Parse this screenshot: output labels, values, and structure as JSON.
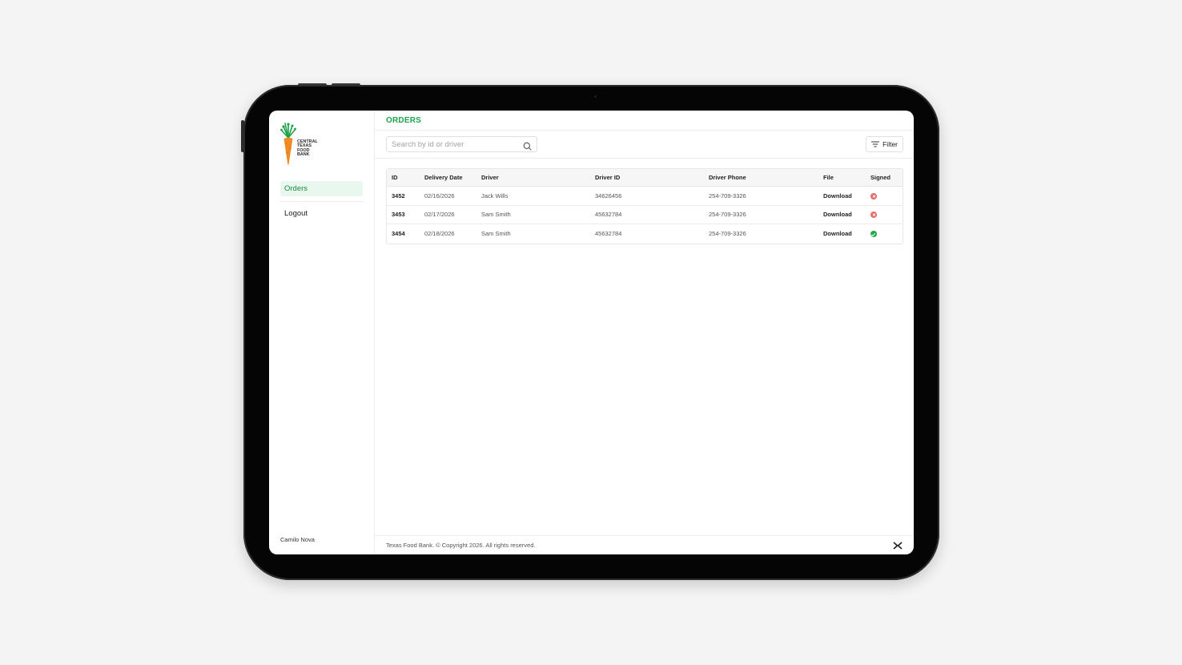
{
  "app": {
    "brand_lines": [
      "CENTRAL",
      "TEXAS",
      "FOOD",
      "BANK"
    ],
    "brand_color": "#1fa24b",
    "carrot_color": "#f08a24"
  },
  "sidebar": {
    "items": [
      {
        "label": "Orders",
        "active": true
      },
      {
        "label": "Logout",
        "active": false
      }
    ],
    "user_name": "Camilo Nova"
  },
  "header": {
    "title": "ORDERS"
  },
  "toolbar": {
    "search_placeholder": "Search by id or driver",
    "search_value": "",
    "filter_label": "Filter"
  },
  "table": {
    "columns": [
      "ID",
      "Delivery Date",
      "Driver",
      "Driver ID",
      "Driver Phone",
      "File",
      "Signed"
    ],
    "rows": [
      {
        "id": "3452",
        "delivery_date": "02/16/2026",
        "driver": "Jack Wills",
        "driver_id": "34626456",
        "driver_phone": "254-709-3326",
        "file": "Download",
        "signed": false
      },
      {
        "id": "3453",
        "delivery_date": "02/17/2026",
        "driver": "Sam Smith",
        "driver_id": "45632784",
        "driver_phone": "254-709-3326",
        "file": "Download",
        "signed": false
      },
      {
        "id": "3454",
        "delivery_date": "02/18/2026",
        "driver": "Sam Smith",
        "driver_id": "45632784",
        "driver_phone": "254-709-3326",
        "file": "Download",
        "signed": true
      }
    ]
  },
  "footer": {
    "copyright": "Texas Food Bank. © Copyright 2026. All rights reserved.",
    "logo_icon": "brand-x-icon"
  },
  "icons": {
    "search": "search-icon",
    "filter": "filter-icon",
    "signed_no": "x-circle-icon",
    "signed_yes": "check-circle-icon"
  }
}
